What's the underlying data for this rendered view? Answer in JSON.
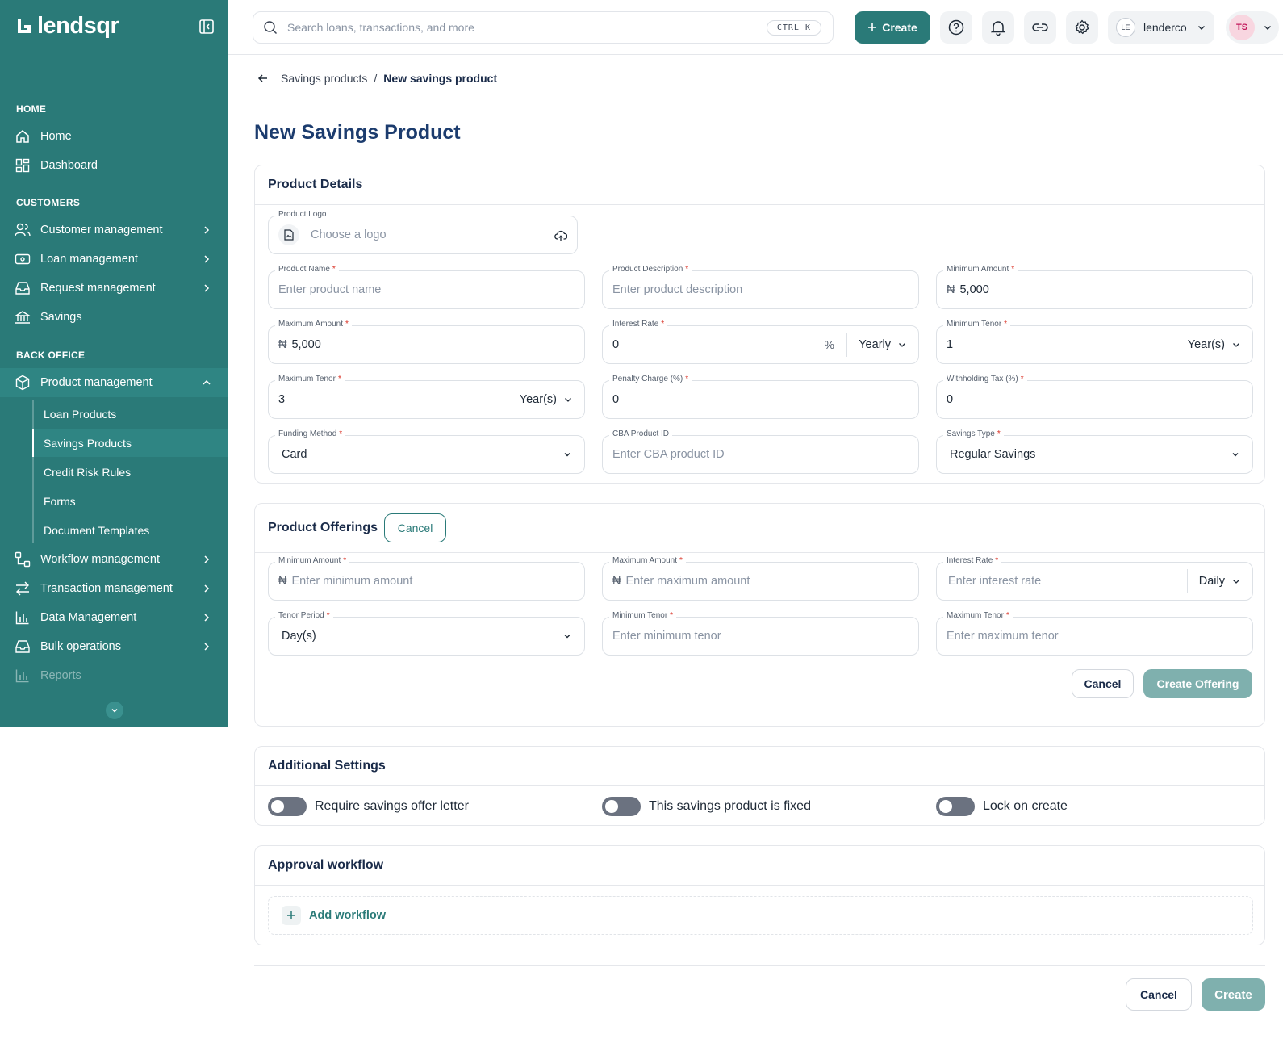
{
  "brand": {
    "name": "lendsqr",
    "accent": "#2a7a78"
  },
  "sidebar": {
    "sections": {
      "home": "HOME",
      "customers": "CUSTOMERS",
      "back_office": "BACK OFFICE"
    },
    "items": {
      "home": "Home",
      "dashboard": "Dashboard",
      "customer_management": "Customer management",
      "loan_management": "Loan management",
      "request_management": "Request management",
      "savings": "Savings",
      "product_management": "Product management",
      "workflow_management": "Workflow management",
      "transaction_management": "Transaction management",
      "data_management": "Data Management",
      "bulk_operations": "Bulk operations",
      "reports": "Reports"
    },
    "sub_items": {
      "loan_products": "Loan Products",
      "savings_products": "Savings Products",
      "credit_risk_rules": "Credit Risk Rules",
      "forms": "Forms",
      "document_templates": "Document Templates"
    }
  },
  "topbar": {
    "search_placeholder": "Search loans, transactions, and more",
    "shortcut": "CTRL K",
    "create_label": "Create",
    "org_initials": "LE",
    "org_name": "lenderco",
    "user_initials": "TS"
  },
  "breadcrumb": {
    "parent": "Savings products",
    "separator": "/",
    "current": "New savings product"
  },
  "page_title": "New Savings Product",
  "product_details": {
    "title": "Product Details",
    "logo": {
      "label": "Product Logo",
      "placeholder": "Choose a logo"
    },
    "name": {
      "label": "Product Name",
      "placeholder": "Enter product name"
    },
    "description": {
      "label": "Product Description",
      "placeholder": "Enter product description"
    },
    "min_amount": {
      "label": "Minimum Amount",
      "currency": "₦",
      "value": "5,000"
    },
    "max_amount": {
      "label": "Maximum Amount",
      "currency": "₦",
      "value": "5,000"
    },
    "interest_rate": {
      "label": "Interest Rate",
      "value": "0",
      "unit": "%",
      "period": "Yearly"
    },
    "min_tenor": {
      "label": "Minimum Tenor",
      "value": "1",
      "unit": "Year(s)"
    },
    "max_tenor": {
      "label": "Maximum Tenor",
      "value": "3",
      "unit": "Year(s)"
    },
    "penalty_charge": {
      "label": "Penalty Charge (%)",
      "value": "0"
    },
    "withholding_tax": {
      "label": "Withholding Tax (%)",
      "value": "0"
    },
    "funding_method": {
      "label": "Funding Method",
      "value": "Card"
    },
    "cba_product_id": {
      "label": "CBA Product ID",
      "placeholder": "Enter CBA product ID"
    },
    "savings_type": {
      "label": "Savings Type",
      "value": "Regular Savings"
    }
  },
  "product_offerings": {
    "title": "Product Offerings",
    "cancel_label": "Cancel",
    "min_amount": {
      "label": "Minimum Amount",
      "currency": "₦",
      "placeholder": "Enter minimum amount"
    },
    "max_amount": {
      "label": "Maximum Amount",
      "currency": "₦",
      "placeholder": "Enter maximum amount"
    },
    "interest_rate": {
      "label": "Interest Rate",
      "placeholder": "Enter interest rate",
      "period": "Daily"
    },
    "tenor_period": {
      "label": "Tenor Period",
      "value": "Day(s)"
    },
    "min_tenor": {
      "label": "Minimum Tenor",
      "placeholder": "Enter minimum tenor"
    },
    "max_tenor": {
      "label": "Maximum Tenor",
      "placeholder": "Enter maximum tenor"
    },
    "footer_cancel": "Cancel",
    "create_offering": "Create Offering"
  },
  "additional_settings": {
    "title": "Additional Settings",
    "toggles": {
      "offer_letter": {
        "label": "Require savings offer letter",
        "on": false
      },
      "fixed": {
        "label": "This savings product is fixed",
        "on": false
      },
      "lock": {
        "label": "Lock on create",
        "on": false
      }
    }
  },
  "approval_workflow": {
    "title": "Approval workflow",
    "add_label": "Add workflow"
  },
  "footer": {
    "cancel": "Cancel",
    "create": "Create"
  }
}
